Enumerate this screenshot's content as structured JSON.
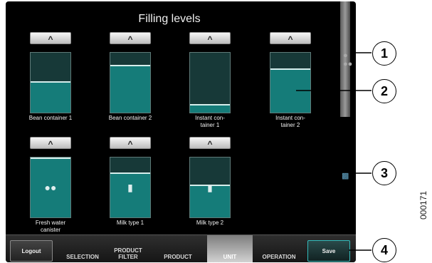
{
  "title": "Filling levels",
  "tiles": [
    {
      "label": "Bean container 1",
      "fill_pct": 50,
      "icon": ""
    },
    {
      "label": "Bean container 2",
      "fill_pct": 77,
      "icon": ""
    },
    {
      "label": "Instant con-\ntainer 1",
      "fill_pct": 12,
      "icon": ""
    },
    {
      "label": "Instant con-\ntainer 2",
      "fill_pct": 71,
      "icon": ""
    },
    {
      "label": "Fresh water\ncanister",
      "fill_pct": 98,
      "icon": "water-drops-icon"
    },
    {
      "label": "Milk type 1",
      "fill_pct": 73,
      "icon": "milk-bottle-icon"
    },
    {
      "label": "Milk type 2",
      "fill_pct": 52,
      "icon": "milk-bottle-icon"
    }
  ],
  "up_button": "^",
  "nav": {
    "logout": "Logout",
    "tabs": [
      "SELECTION",
      "PRODUCT\nFILTER",
      "PRODUCT",
      "UNIT",
      "OPERATION"
    ],
    "active_tab": "UNIT",
    "save": "Save"
  },
  "callouts": [
    "1",
    "2",
    "3",
    "4"
  ],
  "figure_id": "000171"
}
